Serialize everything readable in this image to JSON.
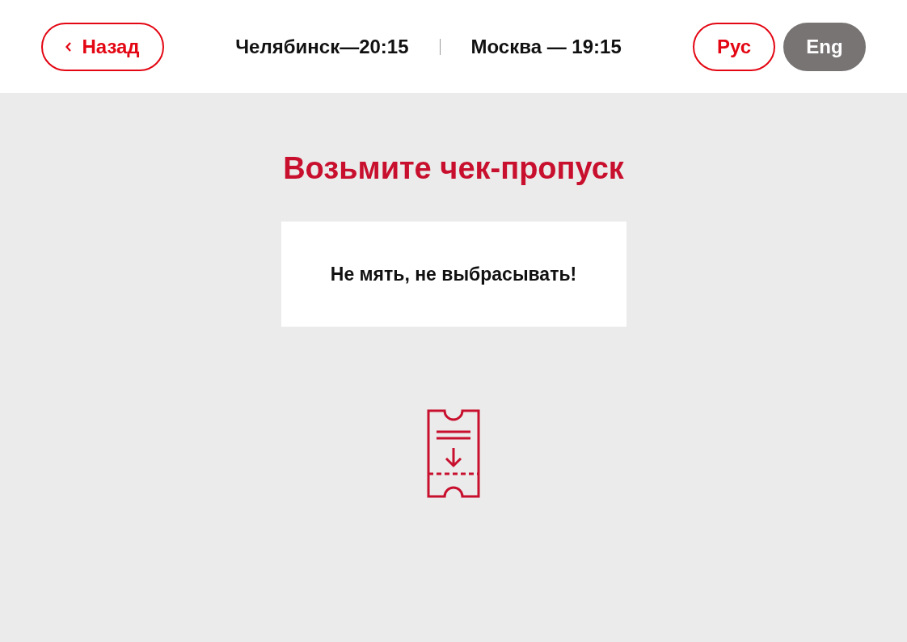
{
  "header": {
    "back_button": {
      "label": "Назад"
    },
    "clocks": [
      {
        "label": "Челябинск—20:15"
      },
      {
        "label": "Москва — 19:15"
      }
    ],
    "languages": [
      {
        "label": "Рус",
        "selected": true
      },
      {
        "label": "Eng",
        "selected": false
      }
    ]
  },
  "title": "Возьмите чек-пропуск",
  "notice": "Не мять, не выбрасывать!"
}
